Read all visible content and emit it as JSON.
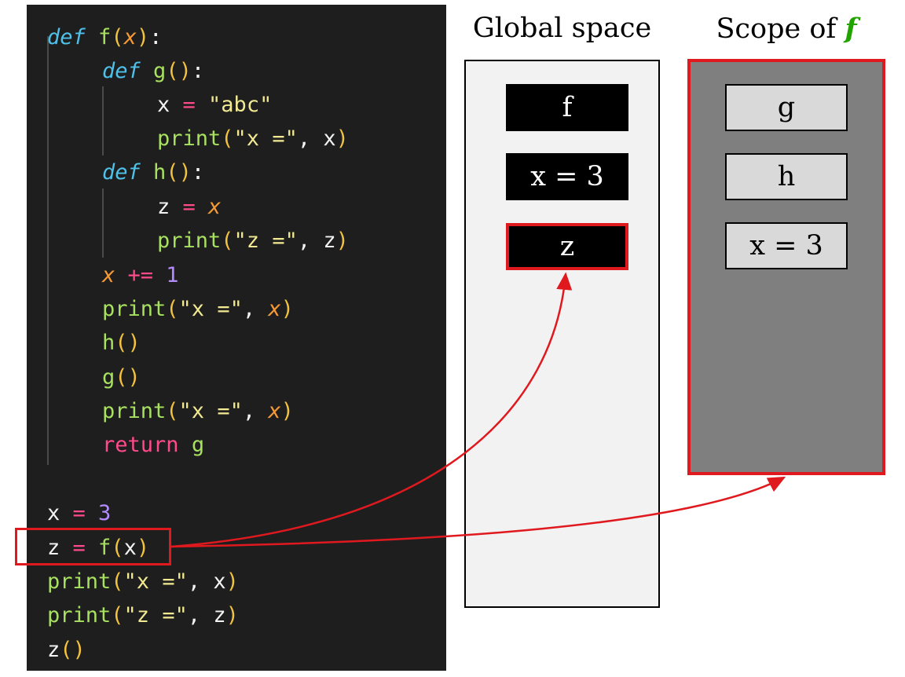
{
  "code": {
    "lines": [
      {
        "tokens": [
          {
            "t": "def",
            "c": "tok-def"
          },
          {
            "t": " ",
            "c": "tok-txt"
          },
          {
            "t": "f",
            "c": "tok-fn"
          },
          {
            "t": "(",
            "c": "tok-br"
          },
          {
            "t": "x",
            "c": "tok-param"
          },
          {
            "t": ")",
            "c": "tok-br"
          },
          {
            "t": ":",
            "c": "tok-txt"
          }
        ]
      },
      {
        "tokens": [
          {
            "t": "def",
            "c": "tok-def"
          },
          {
            "t": " ",
            "c": "tok-txt"
          },
          {
            "t": "g",
            "c": "tok-fn"
          },
          {
            "t": "()",
            "c": "tok-br"
          },
          {
            "t": ":",
            "c": "tok-txt"
          }
        ]
      },
      {
        "tokens": [
          {
            "t": "x",
            "c": "tok-txt"
          },
          {
            "t": " = ",
            "c": "tok-op"
          },
          {
            "t": "\"abc\"",
            "c": "tok-str"
          }
        ]
      },
      {
        "tokens": [
          {
            "t": "print",
            "c": "tok-fn"
          },
          {
            "t": "(",
            "c": "tok-br"
          },
          {
            "t": "\"x =\"",
            "c": "tok-str"
          },
          {
            "t": ", ",
            "c": "tok-comma"
          },
          {
            "t": "x",
            "c": "tok-txt"
          },
          {
            "t": ")",
            "c": "tok-br"
          }
        ]
      },
      {
        "tokens": [
          {
            "t": "def",
            "c": "tok-def"
          },
          {
            "t": " ",
            "c": "tok-txt"
          },
          {
            "t": "h",
            "c": "tok-fn"
          },
          {
            "t": "()",
            "c": "tok-br"
          },
          {
            "t": ":",
            "c": "tok-txt"
          }
        ]
      },
      {
        "tokens": [
          {
            "t": "z",
            "c": "tok-txt"
          },
          {
            "t": " = ",
            "c": "tok-op"
          },
          {
            "t": "x",
            "c": "tok-param"
          }
        ]
      },
      {
        "tokens": [
          {
            "t": "print",
            "c": "tok-fn"
          },
          {
            "t": "(",
            "c": "tok-br"
          },
          {
            "t": "\"z =\"",
            "c": "tok-str"
          },
          {
            "t": ", ",
            "c": "tok-comma"
          },
          {
            "t": "z",
            "c": "tok-txt"
          },
          {
            "t": ")",
            "c": "tok-br"
          }
        ]
      },
      {
        "tokens": [
          {
            "t": "x",
            "c": "tok-param"
          },
          {
            "t": " += ",
            "c": "tok-op"
          },
          {
            "t": "1",
            "c": "tok-num"
          }
        ]
      },
      {
        "tokens": [
          {
            "t": "print",
            "c": "tok-fn"
          },
          {
            "t": "(",
            "c": "tok-br"
          },
          {
            "t": "\"x =\"",
            "c": "tok-str"
          },
          {
            "t": ", ",
            "c": "tok-comma"
          },
          {
            "t": "x",
            "c": "tok-param"
          },
          {
            "t": ")",
            "c": "tok-br"
          }
        ]
      },
      {
        "tokens": [
          {
            "t": "h",
            "c": "tok-fn"
          },
          {
            "t": "()",
            "c": "tok-br"
          }
        ]
      },
      {
        "tokens": [
          {
            "t": "g",
            "c": "tok-fn"
          },
          {
            "t": "()",
            "c": "tok-br"
          }
        ]
      },
      {
        "tokens": [
          {
            "t": "print",
            "c": "tok-fn"
          },
          {
            "t": "(",
            "c": "tok-br"
          },
          {
            "t": "\"x =\"",
            "c": "tok-str"
          },
          {
            "t": ", ",
            "c": "tok-comma"
          },
          {
            "t": "x",
            "c": "tok-param"
          },
          {
            "t": ")",
            "c": "tok-br"
          }
        ]
      },
      {
        "tokens": [
          {
            "t": "return",
            "c": "tok-kw"
          },
          {
            "t": " ",
            "c": "tok-txt"
          },
          {
            "t": "g",
            "c": "tok-fn"
          }
        ]
      },
      {
        "tokens": [
          {
            "t": "x",
            "c": "tok-txt"
          },
          {
            "t": " = ",
            "c": "tok-op"
          },
          {
            "t": "3",
            "c": "tok-num"
          }
        ]
      },
      {
        "tokens": [
          {
            "t": "z",
            "c": "tok-txt"
          },
          {
            "t": " = ",
            "c": "tok-op"
          },
          {
            "t": "f",
            "c": "tok-fn"
          },
          {
            "t": "(",
            "c": "tok-br"
          },
          {
            "t": "x",
            "c": "tok-txt"
          },
          {
            "t": ")",
            "c": "tok-br"
          }
        ]
      },
      {
        "tokens": [
          {
            "t": "print",
            "c": "tok-fn"
          },
          {
            "t": "(",
            "c": "tok-br"
          },
          {
            "t": "\"x =\"",
            "c": "tok-str"
          },
          {
            "t": ", ",
            "c": "tok-comma"
          },
          {
            "t": "x",
            "c": "tok-txt"
          },
          {
            "t": ")",
            "c": "tok-br"
          }
        ]
      },
      {
        "tokens": [
          {
            "t": "print",
            "c": "tok-fn"
          },
          {
            "t": "(",
            "c": "tok-br"
          },
          {
            "t": "\"z =\"",
            "c": "tok-str"
          },
          {
            "t": ", ",
            "c": "tok-comma"
          },
          {
            "t": "z",
            "c": "tok-txt"
          },
          {
            "t": ")",
            "c": "tok-br"
          }
        ]
      },
      {
        "tokens": [
          {
            "t": "z",
            "c": "tok-txt"
          },
          {
            "t": "()",
            "c": "tok-br"
          }
        ]
      }
    ]
  },
  "global_space": {
    "title": "Global space",
    "cells": [
      "f",
      "x = 3",
      "z"
    ]
  },
  "scope_f": {
    "title_prefix": "Scope of ",
    "title_accent": "f",
    "cells": [
      "g",
      "h",
      "x = 3"
    ]
  },
  "colors": {
    "highlight": "#e0191f",
    "accent": "#22a300"
  }
}
